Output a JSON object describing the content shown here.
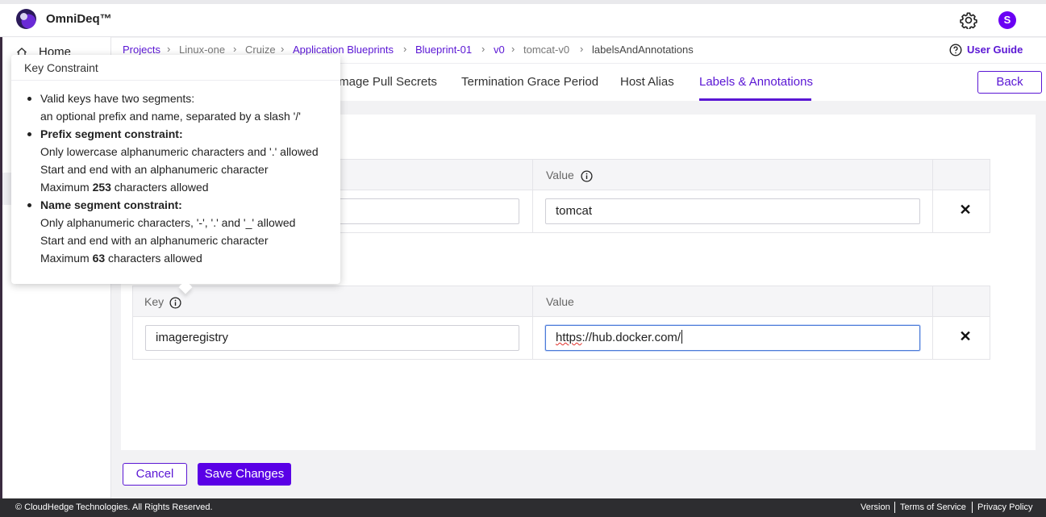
{
  "app": {
    "name": "OmniDeq™",
    "avatar_initial": "S"
  },
  "sidebar": {
    "home_label": "Home"
  },
  "breadcrumb": {
    "items": [
      {
        "label": "Projects"
      },
      {
        "label": "Linux-one"
      },
      {
        "label": "Cruize"
      },
      {
        "label": "Application Blueprints"
      },
      {
        "label": "Blueprint-01"
      },
      {
        "label": "v0"
      },
      {
        "label": "tomcat-v0"
      },
      {
        "label": "labelsAndAnnotations"
      }
    ],
    "separator": "›"
  },
  "user_guide": "User Guide",
  "tabs": [
    {
      "label": "Image Pull Secrets"
    },
    {
      "label": "Termination Grace Period"
    },
    {
      "label": "Host Alias"
    },
    {
      "label": "Labels & Annotations"
    }
  ],
  "back_label": "Back",
  "labels_table": {
    "value_header": "Value",
    "row": {
      "value": "tomcat"
    },
    "remove_icon": "✕"
  },
  "annotations_table": {
    "key_header": "Key",
    "value_header": "Value",
    "row": {
      "key": "imageregistry",
      "value_prefix": "https",
      "value_rest": "://hub.docker.com/"
    },
    "remove_icon": "✕"
  },
  "actions": {
    "cancel": "Cancel",
    "save": "Save Changes"
  },
  "footer": {
    "copyright": "© CloudHedge Technologies. All Rights Reserved.",
    "links": [
      "Version",
      "Terms of Service",
      "Privacy Policy"
    ]
  },
  "popover": {
    "title": "Key Constraint",
    "lines": {
      "l1": "Valid keys have two segments:",
      "l2": "an optional prefix and name, separated by a slash '/'",
      "l3": "Prefix segment constraint:",
      "l4": "Only lowercase alphanumeric characters and '.' allowed",
      "l5": "Start and end with an alphanumeric character",
      "l6_pre": "Maximum ",
      "l6_num": "253",
      "l6_post": " characters allowed",
      "l7": "Name segment constraint:",
      "l8": "Only alphanumeric characters, '-', '.' and '_' allowed",
      "l9": "Start and end with an alphanumeric character",
      "l10_pre": "Maximum ",
      "l10_num": "63",
      "l10_post": " characters allowed"
    }
  },
  "colors": {
    "accent": "#5a16d4",
    "primary_button": "#5a00e6",
    "footer_bg": "#2d2d30"
  }
}
